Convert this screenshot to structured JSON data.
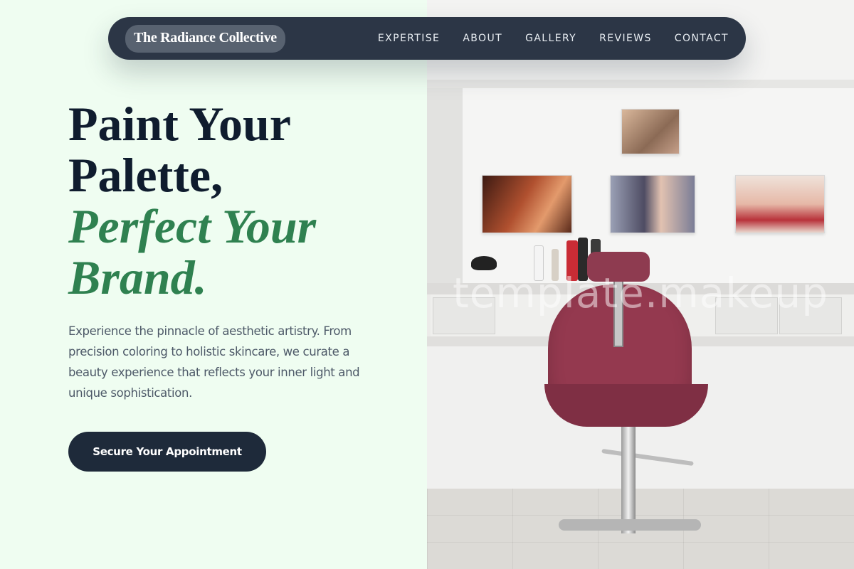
{
  "nav": {
    "brand": "The Radiance Collective",
    "links": [
      "EXPERTISE",
      "ABOUT",
      "GALLERY",
      "REVIEWS",
      "CONTACT"
    ]
  },
  "hero": {
    "headline_line1": "Paint Your",
    "headline_line2": "Palette,",
    "headline_line3": "Perfect Your",
    "headline_line4": "Brand.",
    "description": "Experience the pinnacle of aesthetic artistry. From precision coloring to holistic skincare, we curate a beauty experience that reflects your inner light and unique sophistication.",
    "cta_label": "Secure Your Appointment"
  },
  "photo": {
    "watermark": "template.makeup"
  },
  "colors": {
    "background": "#effdf1",
    "nav_bg": "#2c3646",
    "accent_green": "#2f8150",
    "heading_dark": "#0f1c2e",
    "button_bg": "#1e2a3a",
    "chair_red": "#94394f"
  }
}
